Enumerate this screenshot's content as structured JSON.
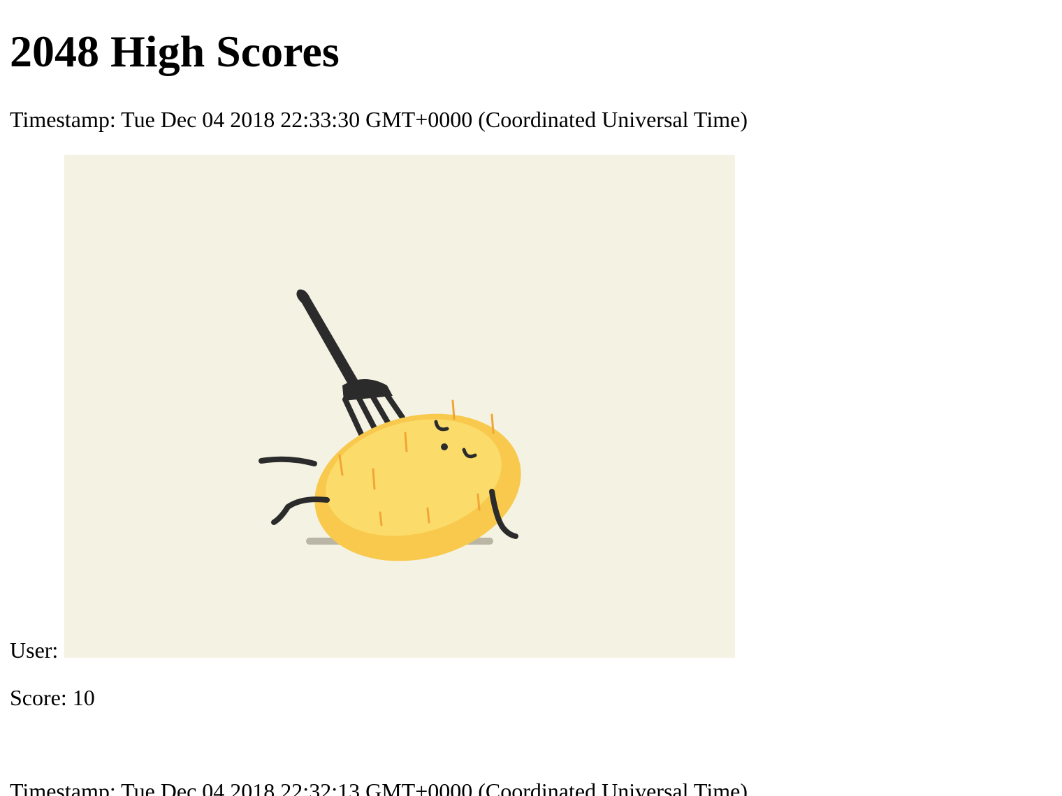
{
  "page": {
    "title": "2048 High Scores"
  },
  "entries": [
    {
      "timestamp_label": "Timestamp: Tue Dec 04 2018 22:33:30 GMT+0000 (Coordinated Universal Time)",
      "user_label": "User:",
      "avatar": {
        "icon": "potato-with-fork-illustration",
        "background": "#f4f2e3",
        "body_color": "#f9d55c",
        "outline_color": "#2b2b2b"
      },
      "score_label": "Score: 10"
    },
    {
      "timestamp_label": "Timestamp: Tue Dec 04 2018 22:32:13 GMT+0000 (Coordinated Universal Time)"
    }
  ]
}
